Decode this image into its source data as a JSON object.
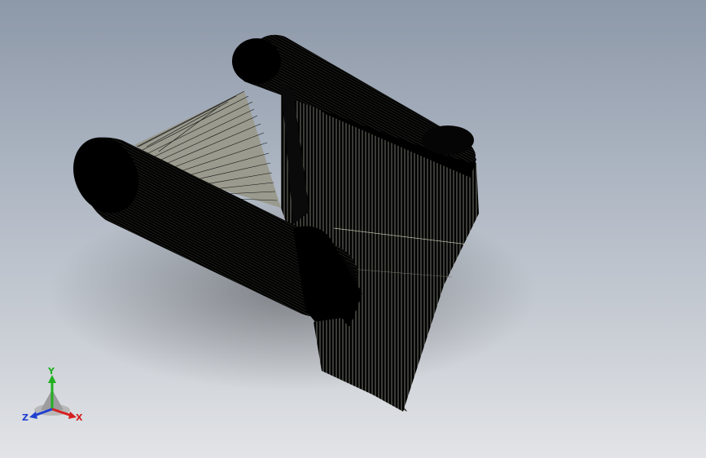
{
  "viewport": {
    "colors": {
      "background_top": "#8d98a8",
      "background_bottom": "#e2e4e7",
      "mesh_edges": "#000000",
      "face_fill": "#9a9a8e"
    }
  },
  "triad": {
    "x_label": "X",
    "y_label": "Y",
    "z_label": "Z",
    "colors": {
      "x": "#d42020",
      "y": "#20b020",
      "z": "#2040d0"
    }
  }
}
